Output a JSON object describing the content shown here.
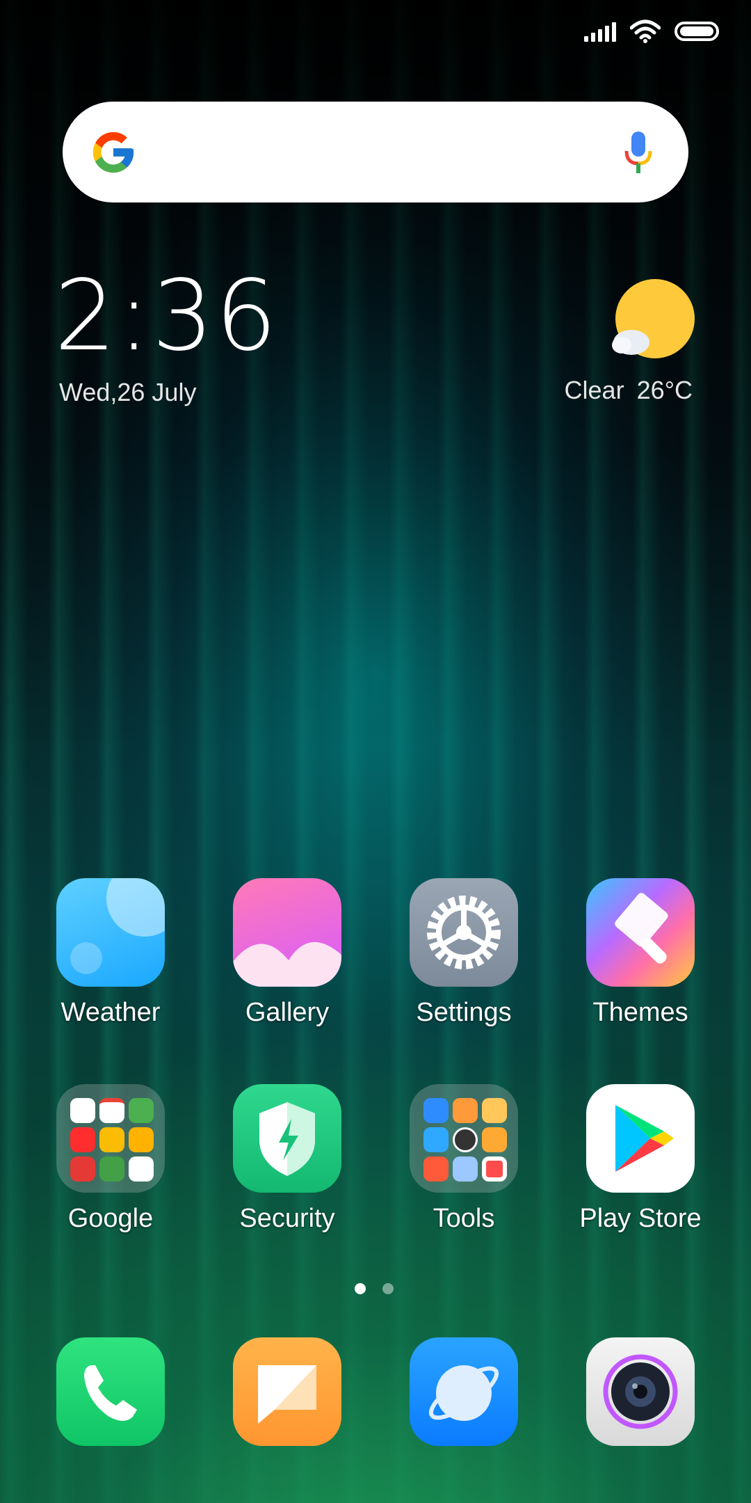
{
  "search": {
    "placeholder": ""
  },
  "clock": {
    "time": "2:36",
    "date": "Wed,26 July"
  },
  "weather": {
    "condition": "Clear",
    "temperature": "26°C"
  },
  "apps_row1": [
    {
      "label": "Weather",
      "icon": "weather-app-icon"
    },
    {
      "label": "Gallery",
      "icon": "gallery-app-icon"
    },
    {
      "label": "Settings",
      "icon": "settings-gear-icon"
    },
    {
      "label": "Themes",
      "icon": "themes-brush-icon"
    }
  ],
  "apps_row2": [
    {
      "label": "Google",
      "icon": "google-folder-icon"
    },
    {
      "label": "Security",
      "icon": "security-shield-icon"
    },
    {
      "label": "Tools",
      "icon": "tools-folder-icon"
    },
    {
      "label": "Play  Store",
      "icon": "play-store-icon"
    }
  ],
  "dock": [
    {
      "icon": "phone-icon"
    },
    {
      "icon": "messages-icon"
    },
    {
      "icon": "browser-icon"
    },
    {
      "icon": "camera-icon"
    }
  ],
  "page_indicator": {
    "pages": 2,
    "current": 1
  },
  "colors": {
    "sun": "#FFC93C",
    "phone": "#19D36E",
    "messages": "#FFA63A",
    "browser": "#1E8EFF"
  }
}
